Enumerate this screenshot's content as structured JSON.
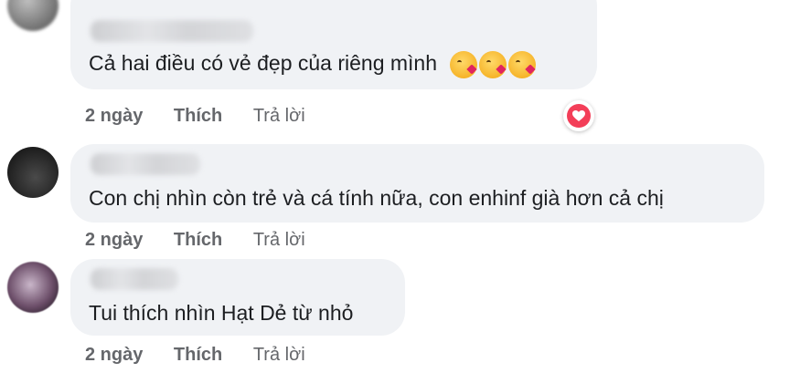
{
  "comments": [
    {
      "text": "Cả hai điều có vẻ đẹp của riêng mình",
      "emojis": [
        "kissing-heart-emoji",
        "kissing-heart-emoji",
        "kissing-heart-emoji"
      ],
      "time": "2 ngày",
      "like_label": "Thích",
      "reply_label": "Trả lời",
      "reaction": "love"
    },
    {
      "text": "Con chị nhìn còn trẻ và cá tính nữa, con enhinf già hơn cả chị",
      "time": "2 ngày",
      "like_label": "Thích",
      "reply_label": "Trả lời"
    },
    {
      "text": "Tui thích nhìn Hạt Dẻ từ nhỏ",
      "time": "2 ngày",
      "like_label": "Thích",
      "reply_label": "Trả lời"
    }
  ],
  "colors": {
    "bubble": "#f0f2f5",
    "action_text": "#65676b",
    "love_react": "#f33e58"
  }
}
